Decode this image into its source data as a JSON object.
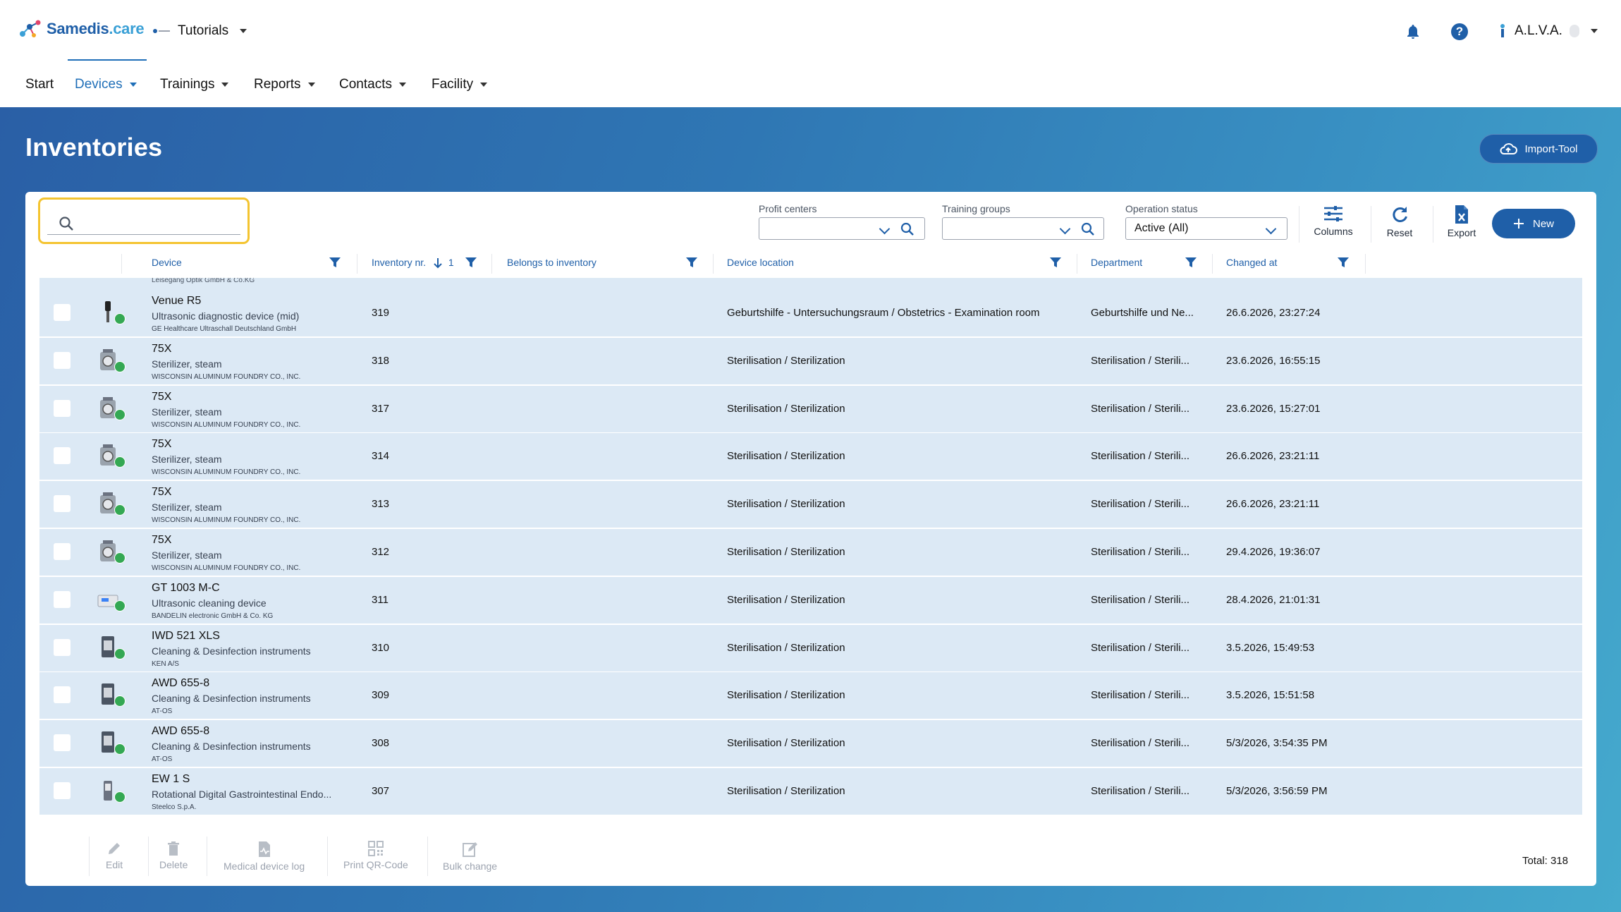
{
  "header": {
    "brand": "Samedis",
    "brand_suffix": ".care",
    "tenant": "Tutorials",
    "user": "A.L.V.A."
  },
  "nav": {
    "items": [
      {
        "label": "Start"
      },
      {
        "label": "Devices"
      },
      {
        "label": "Trainings"
      },
      {
        "label": "Reports"
      },
      {
        "label": "Contacts"
      },
      {
        "label": "Facility"
      }
    ],
    "active": "Devices"
  },
  "page": {
    "title": "Inventories",
    "import_label": "Import-Tool"
  },
  "filters": {
    "search_value": "",
    "profit_centers_label": "Profit centers",
    "profit_centers_value": "",
    "training_groups_label": "Training groups",
    "training_groups_value": "",
    "operation_status_label": "Operation status",
    "operation_status_value": "Active (All)"
  },
  "toolbar": {
    "columns": "Columns",
    "reset": "Reset",
    "export": "Export",
    "new": "New"
  },
  "table": {
    "columns": [
      {
        "label": "Device"
      },
      {
        "label": "Inventory nr."
      },
      {
        "label": "Belongs to inventory"
      },
      {
        "label": "Device location"
      },
      {
        "label": "Department"
      },
      {
        "label": "Changed at"
      }
    ],
    "sort_index": "1",
    "partial_row_manufacturer": "Leisegang Optik GmbH & Co.KG",
    "rows": [
      {
        "name": "Venue R5",
        "type": "Ultrasonic diagnostic device (mid)",
        "manufacturer": "GE Healthcare Ultraschall Deutschland GmbH",
        "inventory": "319",
        "belongs": "",
        "location": "Geburtshilfe - Untersuchungsraum / Obstetrics - Examination room",
        "department": "Geburtshilfe und Ne...",
        "changed": "26.6.2026, 23:27:24",
        "icon": "ultrasound-probe-icon"
      },
      {
        "name": "75X",
        "type": "Sterilizer, steam",
        "manufacturer": "WISCONSIN ALUMINUM FOUNDRY CO., INC.",
        "inventory": "318",
        "belongs": "",
        "location": "Sterilisation / Sterilization",
        "department": "Sterilisation / Sterili...",
        "changed": "23.6.2026, 16:55:15",
        "icon": "sterilizer-icon"
      },
      {
        "name": "75X",
        "type": "Sterilizer, steam",
        "manufacturer": "WISCONSIN ALUMINUM FOUNDRY CO., INC.",
        "inventory": "317",
        "belongs": "",
        "location": "Sterilisation / Sterilization",
        "department": "Sterilisation / Sterili...",
        "changed": "23.6.2026, 15:27:01",
        "icon": "sterilizer-icon"
      },
      {
        "name": "75X",
        "type": "Sterilizer, steam",
        "manufacturer": "WISCONSIN ALUMINUM FOUNDRY CO., INC.",
        "inventory": "314",
        "belongs": "",
        "location": "Sterilisation / Sterilization",
        "department": "Sterilisation / Sterili...",
        "changed": "26.6.2026, 23:21:11",
        "icon": "sterilizer-icon"
      },
      {
        "name": "75X",
        "type": "Sterilizer, steam",
        "manufacturer": "WISCONSIN ALUMINUM FOUNDRY CO., INC.",
        "inventory": "313",
        "belongs": "",
        "location": "Sterilisation / Sterilization",
        "department": "Sterilisation / Sterili...",
        "changed": "26.6.2026, 23:21:11",
        "icon": "sterilizer-icon"
      },
      {
        "name": "75X",
        "type": "Sterilizer, steam",
        "manufacturer": "WISCONSIN ALUMINUM FOUNDRY CO., INC.",
        "inventory": "312",
        "belongs": "",
        "location": "Sterilisation / Sterilization",
        "department": "Sterilisation / Sterili...",
        "changed": "29.4.2026, 19:36:07",
        "icon": "sterilizer-icon"
      },
      {
        "name": "GT 1003 M-C",
        "type": "Ultrasonic cleaning device",
        "manufacturer": "BANDELIN electronic GmbH & Co. KG",
        "inventory": "311",
        "belongs": "",
        "location": "Sterilisation / Sterilization",
        "department": "Sterilisation / Sterili...",
        "changed": "28.4.2026, 21:01:31",
        "icon": "ultrasonic-cleaner-icon"
      },
      {
        "name": "IWD 521 XLS",
        "type": "Cleaning & Desinfection instruments",
        "manufacturer": "KEN A/S",
        "inventory": "310",
        "belongs": "",
        "location": "Sterilisation / Sterilization",
        "department": "Sterilisation / Sterili...",
        "changed": "3.5.2026, 15:49:53",
        "icon": "washer-disinfector-icon"
      },
      {
        "name": "AWD 655-8",
        "type": "Cleaning & Desinfection instruments",
        "manufacturer": "AT-OS",
        "inventory": "309",
        "belongs": "",
        "location": "Sterilisation / Sterilization",
        "department": "Sterilisation / Sterili...",
        "changed": "3.5.2026, 15:51:58",
        "icon": "washer-disinfector-icon"
      },
      {
        "name": "AWD 655-8",
        "type": "Cleaning & Desinfection instruments",
        "manufacturer": "AT-OS",
        "inventory": "308",
        "belongs": "",
        "location": "Sterilisation / Sterilization",
        "department": "Sterilisation / Sterili...",
        "changed": "5/3/2026, 3:54:35 PM",
        "icon": "washer-disinfector-icon"
      },
      {
        "name": "EW 1 S",
        "type": "Rotational Digital Gastrointestinal Endo...",
        "manufacturer": "Steelco S.p.A.",
        "inventory": "307",
        "belongs": "",
        "location": "Sterilisation / Sterilization",
        "department": "Sterilisation / Sterili...",
        "changed": "5/3/2026, 3:56:59 PM",
        "icon": "endoscope-washer-icon"
      }
    ]
  },
  "footer": {
    "edit": "Edit",
    "delete": "Delete",
    "log": "Medical device log",
    "qr": "Print QR-Code",
    "bulk": "Bulk change",
    "total": "Total: 318"
  },
  "colors": {
    "primary": "#1f5fa8",
    "link": "#1f6fb8",
    "row_bg": "#dce9f5",
    "highlight": "#f4c430",
    "status_ok": "#34a853"
  }
}
